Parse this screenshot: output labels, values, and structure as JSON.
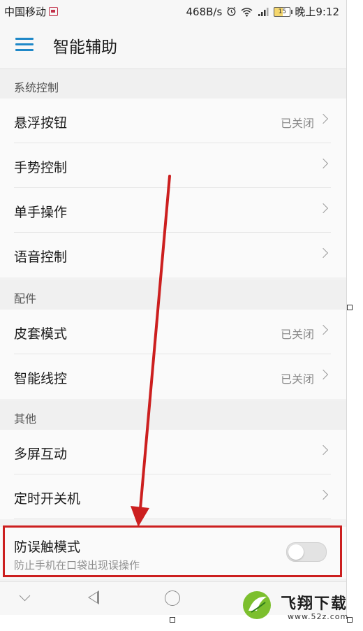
{
  "status_bar": {
    "carrier": "中国移动",
    "net_speed": "468B/s",
    "signal": "⁴ᴳ",
    "battery_level": "15",
    "time": "晚上9:12"
  },
  "header": {
    "title": "智能辅助"
  },
  "sections": [
    {
      "title": "系统控制",
      "items": [
        {
          "label": "悬浮按钮",
          "value": "已关闭"
        },
        {
          "label": "手势控制",
          "value": ""
        },
        {
          "label": "单手操作",
          "value": ""
        },
        {
          "label": "语音控制",
          "value": ""
        }
      ]
    },
    {
      "title": "配件",
      "items": [
        {
          "label": "皮套模式",
          "value": "已关闭"
        },
        {
          "label": "智能线控",
          "value": "已关闭"
        }
      ]
    },
    {
      "title": "其他",
      "items": [
        {
          "label": "多屏互动",
          "value": ""
        },
        {
          "label": "定时开关机",
          "value": ""
        },
        {
          "label": "防误触模式",
          "sublabel": "防止手机在口袋出现误操作",
          "toggle_on": false
        }
      ]
    }
  ],
  "watermark": {
    "title": "飞翔下载",
    "url": "www.52z.com"
  },
  "colors": {
    "accent": "#1f88c8",
    "annotation": "#cc1f1f"
  },
  "icons": {
    "menu": "hamburger-menu-icon",
    "chevron": "chevron-right-icon",
    "nav_down": "chevron-down-icon",
    "nav_back": "back-triangle-icon",
    "nav_home": "home-circle-icon"
  }
}
